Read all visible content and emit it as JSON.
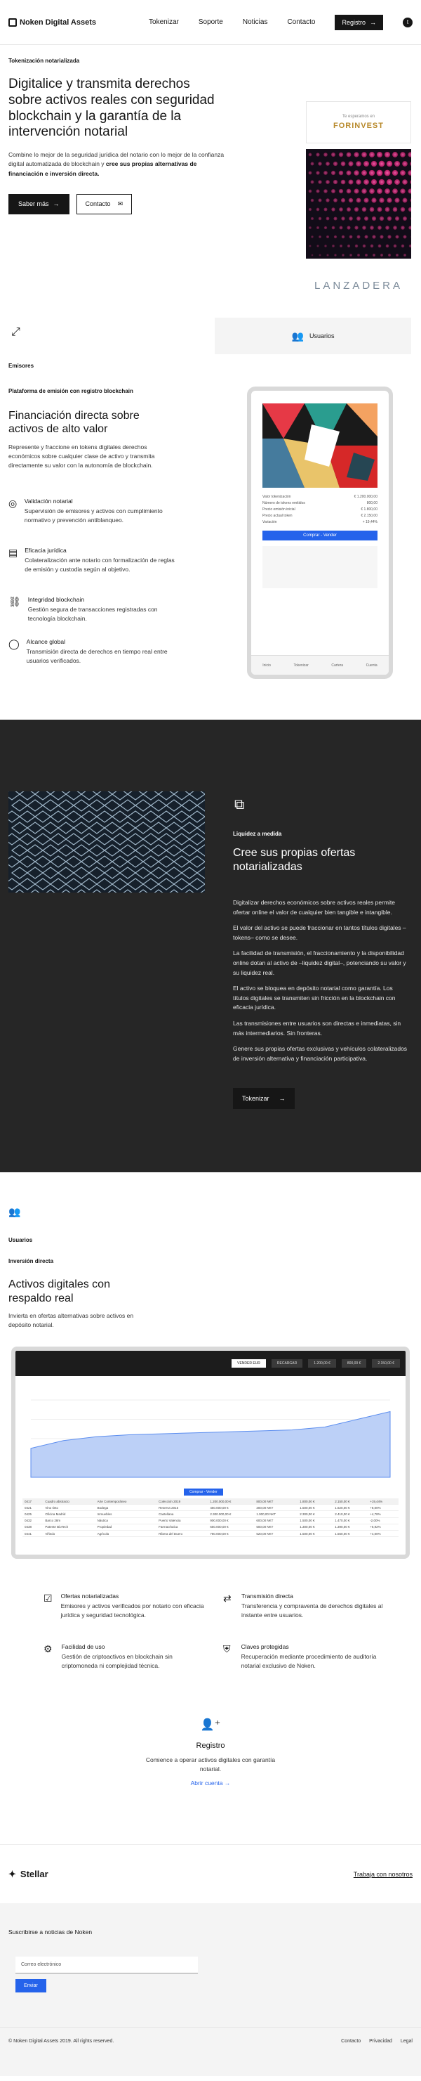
{
  "header": {
    "brand": "Noken Digital Assets",
    "nav": [
      "Tokenizar",
      "Soporte",
      "Noticias",
      "Contacto"
    ],
    "register_label": "Registro",
    "twitter_icon": "twitter-icon"
  },
  "hero": {
    "tag": "Tokenización notarializada",
    "title": "Digitalice y transmita derechos sobre activos reales con seguridad blockchain y la garantía de la intervención notarial",
    "body_plain": "Combine lo mejor de la seguridad jurídica del notario con lo mejor de la confianza digital automatizada de blockchain y ",
    "body_bold": "cree sus propias alternativas de financiación e inversión directa.",
    "cta_primary": "Saber más",
    "cta_secondary": "Contacto",
    "forinvest_sub": "Te esperamos en",
    "forinvest_name": "FORINVEST",
    "lanzadera": "LANZADERA",
    "users_label": "Usuarios"
  },
  "emisores": {
    "label": "Emisores",
    "platform_label": "Plataforma de emisión con registro blockchain",
    "title": "Financiación directa sobre activos de alto valor",
    "desc": "Represente y fraccione en tokens digitales derechos económicos sobre cualquier clase de activo y transmita directamente su valor con la autonomía de blockchain.",
    "features": [
      {
        "title": "Validación notarial",
        "desc": "Supervisión de emisores y activos con cumplimiento normativo y prevención antiblanqueo."
      },
      {
        "title": "Eficacia jurídica",
        "desc": "Colateralización ante notario con formalización de reglas de emisión y custodia según al objetivo."
      },
      {
        "title": "Integridad blockchain",
        "desc": "Gestión segura de transacciones registradas con tecnología blockchain."
      },
      {
        "title": "Alcance global",
        "desc": "Transmisión directa de derechos en tiempo real entre usuarios verificados."
      }
    ],
    "phone": {
      "rows": [
        [
          "Valor tokenización",
          "€ 1.200.000,00"
        ],
        [
          "Número de tokens emitidos",
          "800,00"
        ],
        [
          "Precio emisión inicial",
          "€ 1.800,00"
        ],
        [
          "Precio actual token",
          "€ 2.150,00"
        ],
        [
          "Variación",
          "+ 19,44%"
        ]
      ],
      "buy_label": "Comprar - Vender",
      "tabs": [
        "Inicio",
        "Tokenizar",
        "Cartera",
        "Cuenta"
      ]
    }
  },
  "dark": {
    "label": "Liquidez a medida",
    "title": "Cree sus propias ofertas notarializadas",
    "paras": [
      "Digitalizar derechos económicos sobre activos reales permite ofertar online el valor de cualquier bien tangible e intangible.",
      "El valor del activo se puede fraccionar en tantos títulos digitales –tokens– como se desee.",
      "La facilidad de transmisión, el fraccionamiento y la disponibilidad online dotan al activo de –liquidez digital–, potenciando su valor y su liquidez real.",
      "El activo se bloquea en depósito notarial como garantía. Los títulos digitales se transmiten sin fricción en la blockchain con eficacia jurídica.",
      "Las transmisiones entre usuarios son directas e inmediatas, sin más intermediarios. Sin fronteras.",
      "Genere sus propias ofertas exclusivas y vehículos colateralizados de inversión alternativa y financiación participativa."
    ],
    "cta": "Tokenizar"
  },
  "usuarios": {
    "label": "Usuarios",
    "sublabel": "Inversión directa",
    "title": "Activos digitales con respaldo real",
    "desc": "Invierta en ofertas alternativas sobre activos en depósito notarial.",
    "dashboard": {
      "pills": [
        "VENDER EUR",
        "RECARGAR",
        "1.200,00 €",
        "800,00 €",
        "2.150,00 €"
      ],
      "buy_label": "Comprar - Vender",
      "rows": [
        [
          "0417",
          "Cuadro abstracto",
          "Arte Contemporáneo",
          "Colección 2019",
          "1.200.000,00 €",
          "800,00 NKT",
          "1.800,00 €",
          "2.150,00 €",
          "+19,44%"
        ],
        [
          "0421",
          "Vino tinto",
          "Bodega",
          "Reserva 2015",
          "450.000,00 €",
          "300,00 NKT",
          "1.500,00 €",
          "1.620,00 €",
          "+8,00%"
        ],
        [
          "0425",
          "Oficina Madrid",
          "Inmuebles",
          "Castellana",
          "2.300.000,00 €",
          "1.000,00 NKT",
          "2.300,00 €",
          "2.410,00 €",
          "+4,78%"
        ],
        [
          "0432",
          "Barco 28m",
          "Náutica",
          "Puerto Valencia",
          "900.000,00 €",
          "600,00 NKT",
          "1.500,00 €",
          "1.470,00 €",
          "-2,00%"
        ],
        [
          "0438",
          "Patente BioTech",
          "Propiedad",
          "Farmacéutica",
          "650.000,00 €",
          "500,00 NKT",
          "1.300,00 €",
          "1.390,00 €",
          "+6,92%"
        ],
        [
          "0441",
          "Viñedo",
          "Agrícola",
          "Ribera del Duero",
          "780.000,00 €",
          "520,00 NKT",
          "1.500,00 €",
          "1.560,00 €",
          "+4,00%"
        ]
      ]
    },
    "chart_data": {
      "type": "area",
      "title": "",
      "x": [
        1,
        2,
        3,
        4,
        5,
        6,
        7,
        8,
        9,
        10,
        11,
        12
      ],
      "values": [
        30,
        38,
        42,
        44,
        45,
        46,
        47,
        48,
        49,
        52,
        60,
        68
      ]
    }
  },
  "features": [
    {
      "title": "Ofertas notarializadas",
      "desc": "Emisores y activos verificados por notario con eficacia jurídica y seguridad tecnológica.",
      "icon": "checklist-icon"
    },
    {
      "title": "Transmisión directa",
      "desc": "Transferencia y compraventa de derechos digitales al instante entre usuarios.",
      "icon": "users-transfer-icon"
    },
    {
      "title": "Facilidad de uso",
      "desc": "Gestión de criptoactivos en blockchain sin criptomoneda ni complejidad técnica.",
      "icon": "gear-icon"
    },
    {
      "title": "Claves protegidas",
      "desc": "Recuperación mediante procedimiento de auditoría notarial exclusivo de Noken.",
      "icon": "shield-key-icon"
    }
  ],
  "registro": {
    "title": "Registro",
    "desc": "Comience a operar activos digitales con garantía notarial.",
    "link": "Abrir cuenta"
  },
  "partner": {
    "stellar": "Stellar",
    "jobs": "Trabaja con nosotros"
  },
  "newsletter": {
    "title": "Suscribirse a noticias de Noken",
    "placeholder": "Correo electrónico",
    "button": "Enviar"
  },
  "footer": {
    "copyright": "© Noken Digital Assets 2019. All rights reserved.",
    "links": [
      "Contacto",
      "Privacidad",
      "Legal"
    ]
  }
}
